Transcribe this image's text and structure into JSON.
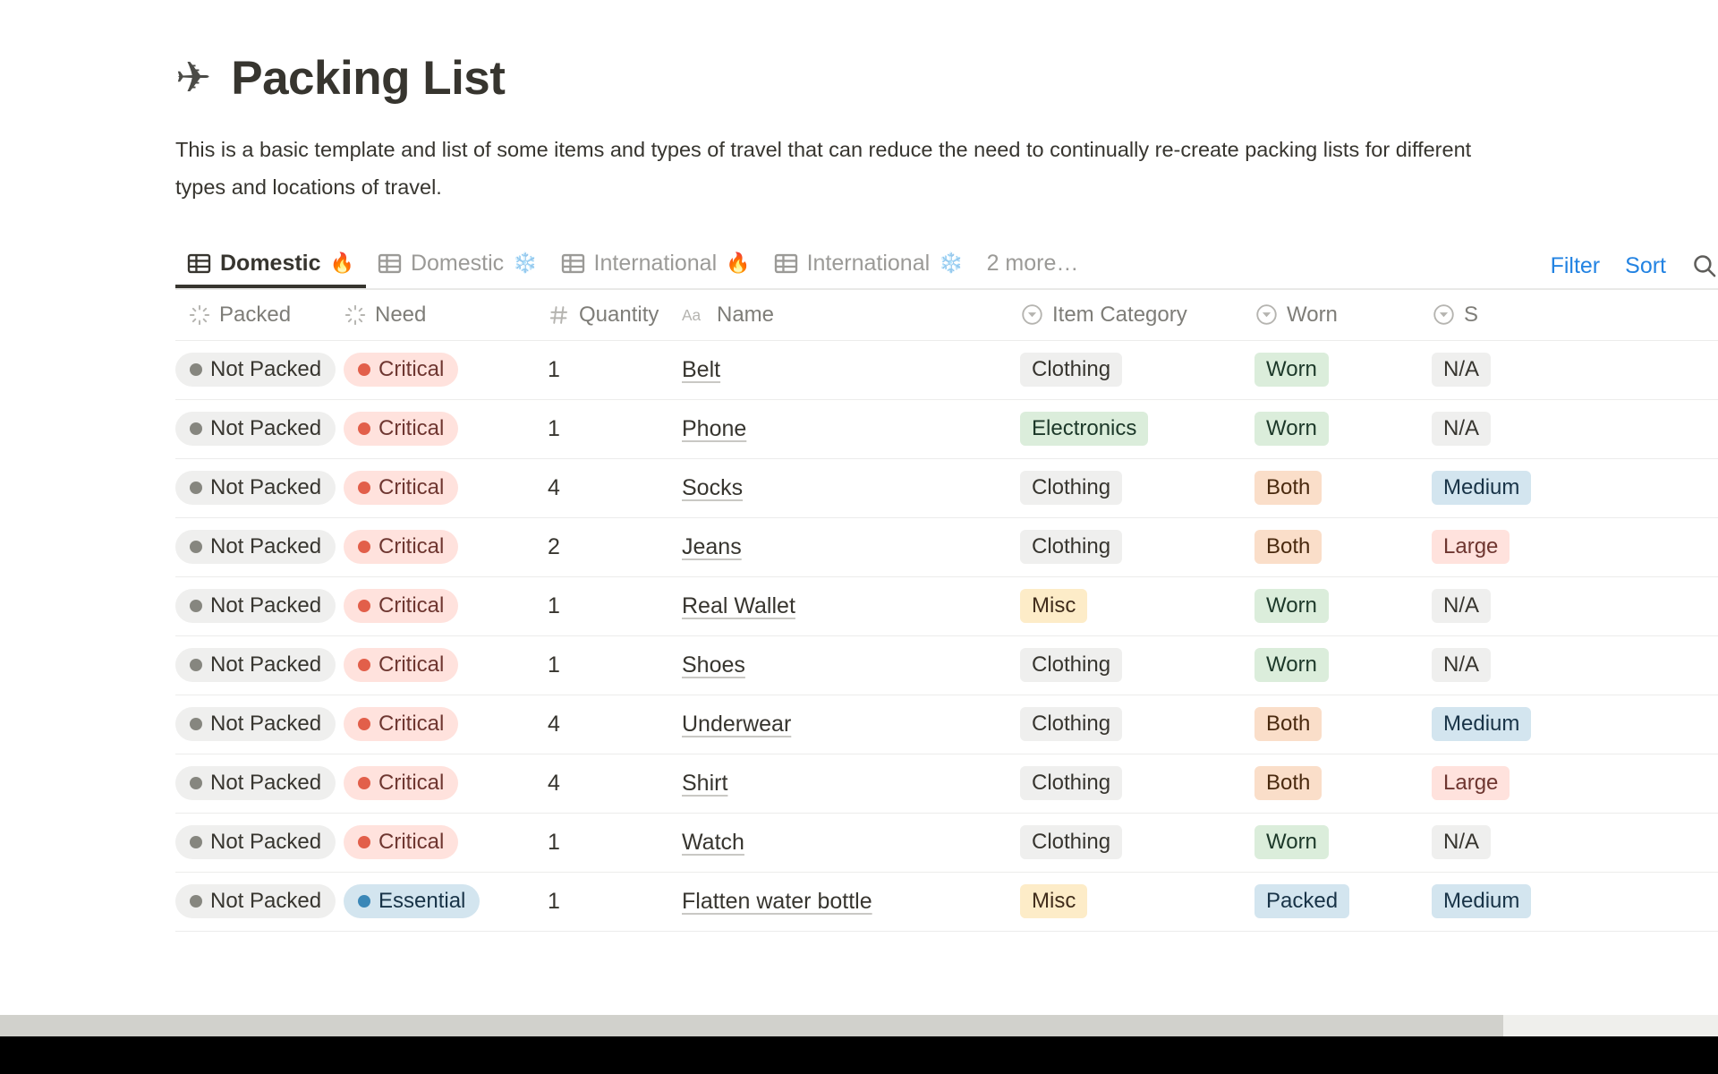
{
  "header": {
    "emoji": "✈",
    "emoji_name": "airplane-icon",
    "title": "Packing List",
    "description": "This is a basic template and list of some items and types of travel that can reduce the need to continually re-create packing lists for different types and locations of travel."
  },
  "views": {
    "tabs": [
      {
        "label": "Domestic",
        "emoji": "🔥",
        "active": true
      },
      {
        "label": "Domestic",
        "emoji": "❄️",
        "active": false
      },
      {
        "label": "International",
        "emoji": "🔥",
        "active": false
      },
      {
        "label": "International",
        "emoji": "❄️",
        "active": false
      }
    ],
    "more_label": "2 more…",
    "filter_label": "Filter",
    "sort_label": "Sort",
    "search_icon": "search-icon",
    "accent_color": "#2383e2"
  },
  "table": {
    "columns": [
      {
        "key": "packed",
        "label": "Packed",
        "type_icon": "select-icon"
      },
      {
        "key": "need",
        "label": "Need",
        "type_icon": "select-icon"
      },
      {
        "key": "quantity",
        "label": "Quantity",
        "type_icon": "number-icon"
      },
      {
        "key": "name",
        "label": "Name",
        "type_icon": "text-icon"
      },
      {
        "key": "category",
        "label": "Item Category",
        "type_icon": "select-dropdown-icon"
      },
      {
        "key": "worn",
        "label": "Worn",
        "type_icon": "select-dropdown-icon"
      },
      {
        "key": "size",
        "label": "S",
        "type_icon": "select-dropdown-icon"
      }
    ],
    "rows": [
      {
        "packed": {
          "text": "Not Packed",
          "style": "pill-gray round",
          "dot": "dot-gray"
        },
        "need": {
          "text": "Critical",
          "style": "pill-red round",
          "dot": "dot-red"
        },
        "quantity": "1",
        "name": "Belt",
        "category": {
          "text": "Clothing",
          "style": "pill-gray"
        },
        "worn": {
          "text": "Worn",
          "style": "pill-green"
        },
        "size": {
          "text": "N/A",
          "style": "pill-gray"
        }
      },
      {
        "packed": {
          "text": "Not Packed",
          "style": "pill-gray round",
          "dot": "dot-gray"
        },
        "need": {
          "text": "Critical",
          "style": "pill-red round",
          "dot": "dot-red"
        },
        "quantity": "1",
        "name": "Phone",
        "category": {
          "text": "Electronics",
          "style": "pill-green"
        },
        "worn": {
          "text": "Worn",
          "style": "pill-green"
        },
        "size": {
          "text": "N/A",
          "style": "pill-gray"
        }
      },
      {
        "packed": {
          "text": "Not Packed",
          "style": "pill-gray round",
          "dot": "dot-gray"
        },
        "need": {
          "text": "Critical",
          "style": "pill-red round",
          "dot": "dot-red"
        },
        "quantity": "4",
        "name": "Socks",
        "category": {
          "text": "Clothing",
          "style": "pill-gray"
        },
        "worn": {
          "text": "Both",
          "style": "pill-orange"
        },
        "size": {
          "text": "Medium",
          "style": "pill-blue"
        }
      },
      {
        "packed": {
          "text": "Not Packed",
          "style": "pill-gray round",
          "dot": "dot-gray"
        },
        "need": {
          "text": "Critical",
          "style": "pill-red round",
          "dot": "dot-red"
        },
        "quantity": "2",
        "name": "Jeans",
        "category": {
          "text": "Clothing",
          "style": "pill-gray"
        },
        "worn": {
          "text": "Both",
          "style": "pill-orange"
        },
        "size": {
          "text": "Large",
          "style": "pill-red"
        }
      },
      {
        "packed": {
          "text": "Not Packed",
          "style": "pill-gray round",
          "dot": "dot-gray"
        },
        "need": {
          "text": "Critical",
          "style": "pill-red round",
          "dot": "dot-red"
        },
        "quantity": "1",
        "name": "Real Wallet",
        "category": {
          "text": "Misc",
          "style": "pill-yellow"
        },
        "worn": {
          "text": "Worn",
          "style": "pill-green"
        },
        "size": {
          "text": "N/A",
          "style": "pill-gray"
        }
      },
      {
        "packed": {
          "text": "Not Packed",
          "style": "pill-gray round",
          "dot": "dot-gray"
        },
        "need": {
          "text": "Critical",
          "style": "pill-red round",
          "dot": "dot-red"
        },
        "quantity": "1",
        "name": "Shoes",
        "category": {
          "text": "Clothing",
          "style": "pill-gray"
        },
        "worn": {
          "text": "Worn",
          "style": "pill-green"
        },
        "size": {
          "text": "N/A",
          "style": "pill-gray"
        }
      },
      {
        "packed": {
          "text": "Not Packed",
          "style": "pill-gray round",
          "dot": "dot-gray"
        },
        "need": {
          "text": "Critical",
          "style": "pill-red round",
          "dot": "dot-red"
        },
        "quantity": "4",
        "name": "Underwear",
        "category": {
          "text": "Clothing",
          "style": "pill-gray"
        },
        "worn": {
          "text": "Both",
          "style": "pill-orange"
        },
        "size": {
          "text": "Medium",
          "style": "pill-blue"
        }
      },
      {
        "packed": {
          "text": "Not Packed",
          "style": "pill-gray round",
          "dot": "dot-gray"
        },
        "need": {
          "text": "Critical",
          "style": "pill-red round",
          "dot": "dot-red"
        },
        "quantity": "4",
        "name": "Shirt",
        "category": {
          "text": "Clothing",
          "style": "pill-gray"
        },
        "worn": {
          "text": "Both",
          "style": "pill-orange"
        },
        "size": {
          "text": "Large",
          "style": "pill-red"
        }
      },
      {
        "packed": {
          "text": "Not Packed",
          "style": "pill-gray round",
          "dot": "dot-gray"
        },
        "need": {
          "text": "Critical",
          "style": "pill-red round",
          "dot": "dot-red"
        },
        "quantity": "1",
        "name": "Watch",
        "category": {
          "text": "Clothing",
          "style": "pill-gray"
        },
        "worn": {
          "text": "Worn",
          "style": "pill-green"
        },
        "size": {
          "text": "N/A",
          "style": "pill-gray"
        }
      },
      {
        "packed": {
          "text": "Not Packed",
          "style": "pill-gray round",
          "dot": "dot-gray"
        },
        "need": {
          "text": "Essential",
          "style": "pill-blue round",
          "dot": "dot-blue"
        },
        "quantity": "1",
        "name": "Flatten water bottle",
        "category": {
          "text": "Misc",
          "style": "pill-yellow"
        },
        "worn": {
          "text": "Packed",
          "style": "pill-blue"
        },
        "size": {
          "text": "Medium",
          "style": "pill-blue"
        }
      }
    ]
  }
}
